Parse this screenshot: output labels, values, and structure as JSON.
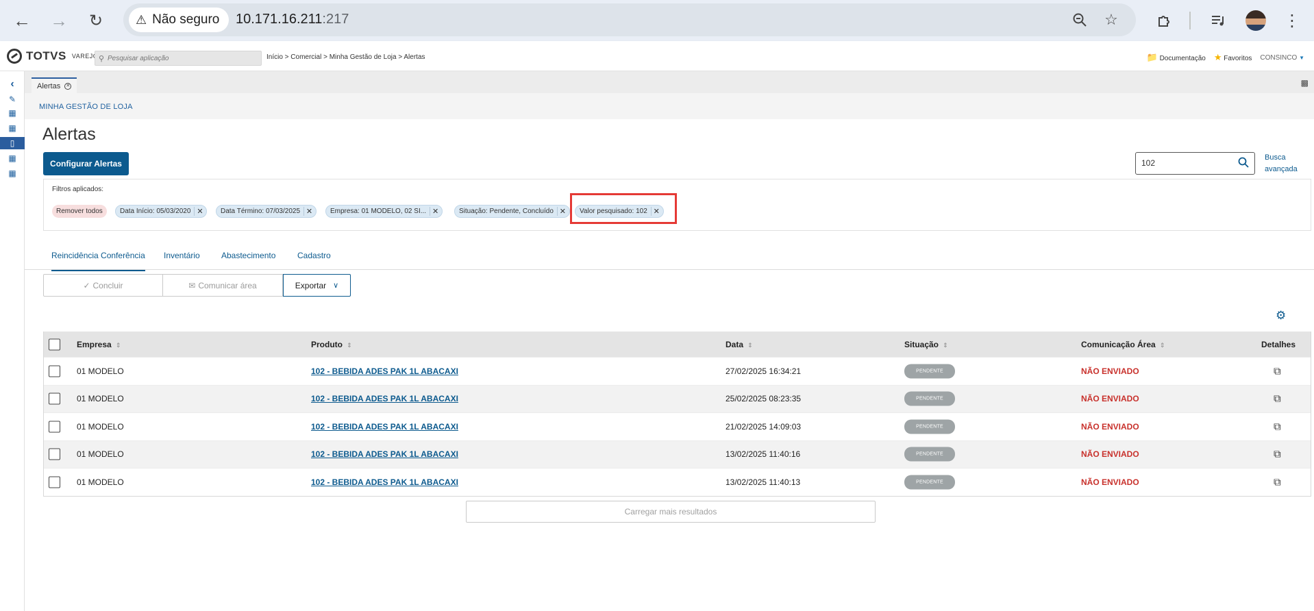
{
  "browser": {
    "security_label": "Não seguro",
    "url_host": "10.171.16.211",
    "url_port": ":217"
  },
  "header": {
    "logo_text": "TOTVS",
    "logo_sub": "VAREJO",
    "search_placeholder": "Pesquisar aplicação",
    "breadcrumb": "Início > Comercial > Minha Gestão de Loja > Alertas",
    "documentation_label": "Documentação",
    "favorites_label": "Favoritos",
    "user_label": "CONSINCO"
  },
  "tabs_strip": {
    "active_tab": "Alertas"
  },
  "module": {
    "name": "MINHA GESTÃO DE LOJA"
  },
  "page": {
    "title": "Alertas",
    "configure_button": "Configurar Alertas",
    "search_value": "102",
    "advanced_search_line1": "Busca",
    "advanced_search_line2": "avançada"
  },
  "filters": {
    "label": "Filtros aplicados:",
    "remove_all": "Remover todos",
    "chips": [
      "Data Início: 05/03/2020",
      "Data Término: 07/03/2025",
      "Empresa: 01 MODELO, 02 SI...",
      "Situação: Pendente, Concluído",
      "Valor pesquisado: 102"
    ]
  },
  "section_tabs": [
    "Reincidência Conferência",
    "Inventário",
    "Abastecimento",
    "Cadastro"
  ],
  "actions": {
    "conclude": "Concluir",
    "communicate": "Comunicar área",
    "export": "Exportar"
  },
  "table": {
    "columns": [
      "Empresa",
      "Produto",
      "Data",
      "Situação",
      "Comunicação Área",
      "Detalhes"
    ],
    "rows": [
      {
        "empresa": "01 MODELO",
        "produto": "102 - BEBIDA ADES PAK 1L ABACAXI",
        "data": "27/02/2025 16:34:21",
        "situacao": "PENDENTE",
        "comunicacao": "NÃO ENVIADO"
      },
      {
        "empresa": "01 MODELO",
        "produto": "102 - BEBIDA ADES PAK 1L ABACAXI",
        "data": "25/02/2025 08:23:35",
        "situacao": "PENDENTE",
        "comunicacao": "NÃO ENVIADO"
      },
      {
        "empresa": "01 MODELO",
        "produto": "102 - BEBIDA ADES PAK 1L ABACAXI",
        "data": "21/02/2025 14:09:03",
        "situacao": "PENDENTE",
        "comunicacao": "NÃO ENVIADO"
      },
      {
        "empresa": "01 MODELO",
        "produto": "102 - BEBIDA ADES PAK 1L ABACAXI",
        "data": "13/02/2025 11:40:16",
        "situacao": "PENDENTE",
        "comunicacao": "NÃO ENVIADO"
      },
      {
        "empresa": "01 MODELO",
        "produto": "102 - BEBIDA ADES PAK 1L ABACAXI",
        "data": "13/02/2025 11:40:13",
        "situacao": "PENDENTE",
        "comunicacao": "NÃO ENVIADO"
      }
    ]
  },
  "load_more": "Carregar mais resultados",
  "colors": {
    "primary": "#0c5a8e",
    "alert_red": "#c8312c",
    "highlight": "#e53935",
    "badge_grey": "#9ea4a6"
  }
}
